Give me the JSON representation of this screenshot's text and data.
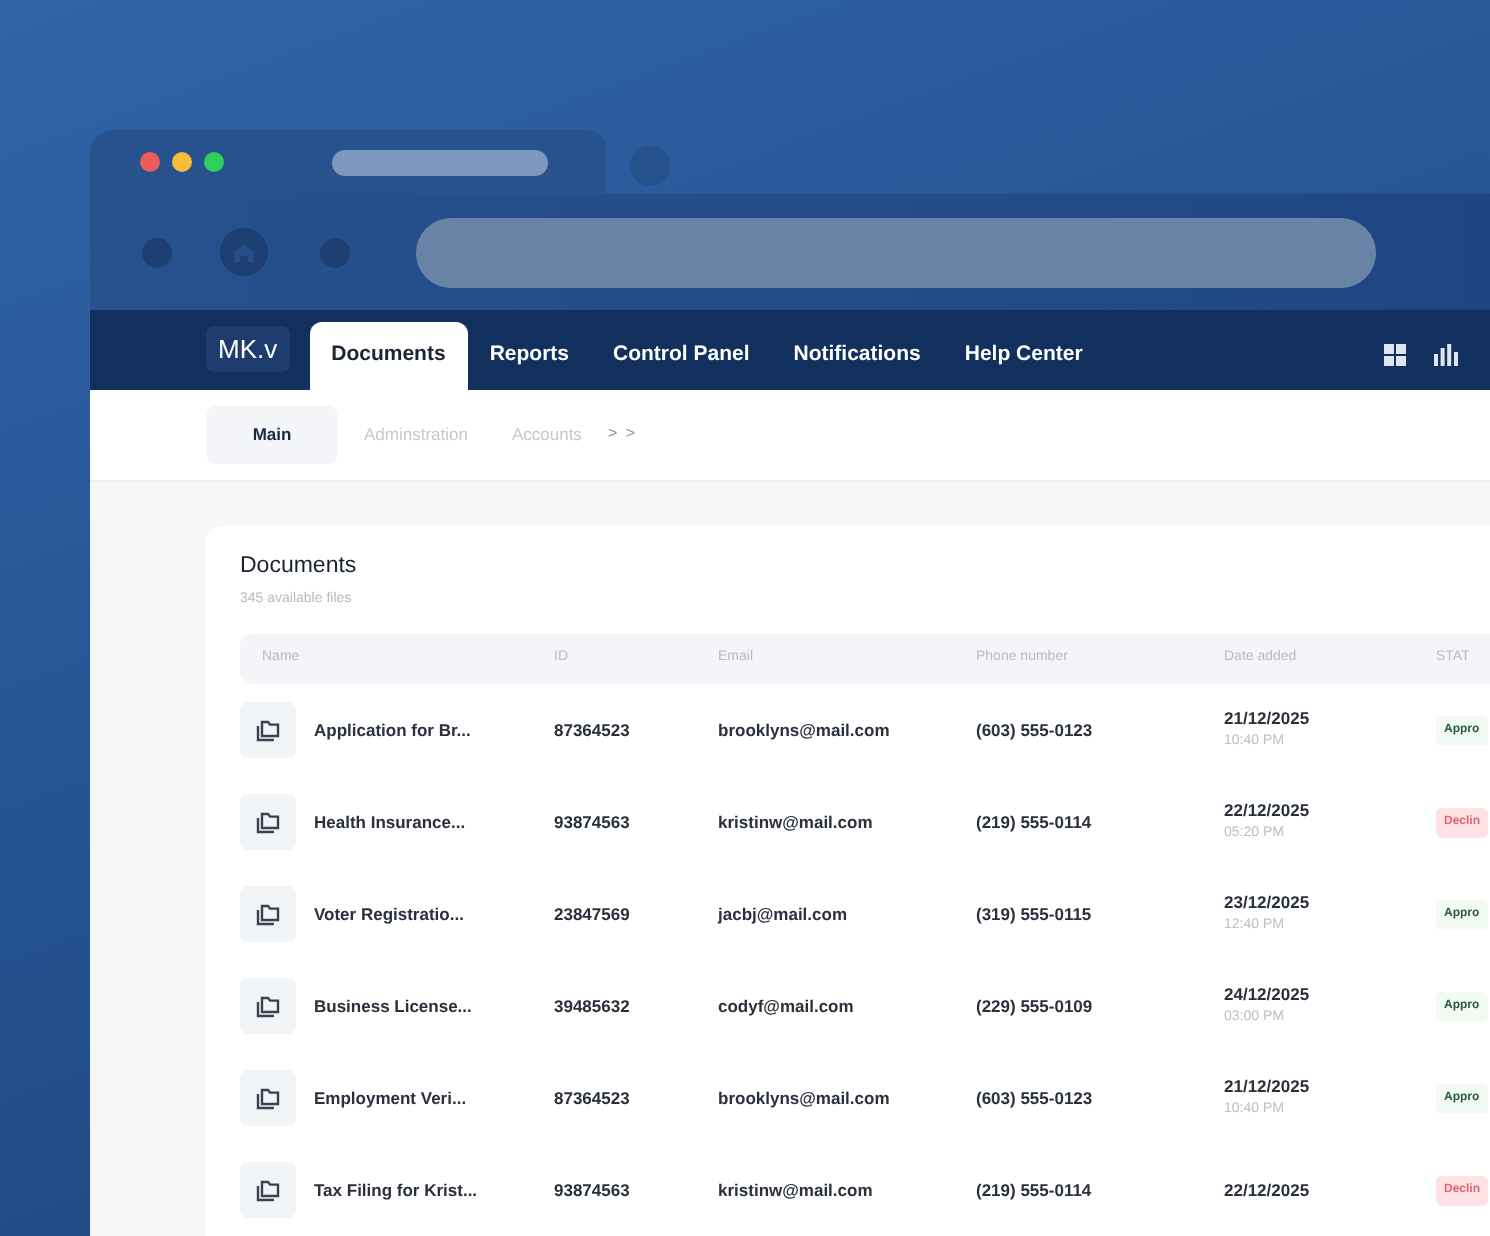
{
  "app_nav": {
    "logo": "MK.v",
    "tabs": [
      {
        "label": "Documents",
        "selected": true
      },
      {
        "label": "Reports",
        "selected": false
      },
      {
        "label": "Control Panel",
        "selected": false
      },
      {
        "label": "Notifications",
        "selected": false
      },
      {
        "label": "Help Center",
        "selected": false
      }
    ]
  },
  "sub_nav": {
    "tabs": [
      {
        "label": "Main",
        "selected": true
      },
      {
        "label": "Adminstration",
        "selected": false
      },
      {
        "label": "Accounts",
        "selected": false
      }
    ],
    "more": "> >"
  },
  "documents": {
    "title": "Documents",
    "subtitle": "345 available files",
    "columns": [
      "Name",
      "ID",
      "Email",
      "Phone number",
      "Date added",
      "STAT"
    ],
    "rows": [
      {
        "name": "Application for Br...",
        "id": "87364523",
        "email": "brooklyns@mail.com",
        "phone": "(603) 555-0123",
        "date": "21/12/2025",
        "time": "10:40 PM",
        "status": {
          "kind": "approved",
          "label": "Appro"
        }
      },
      {
        "name": "Health Insurance...",
        "id": "93874563",
        "email": "kristinw@mail.com",
        "phone": "(219) 555-0114",
        "date": "22/12/2025",
        "time": "05:20 PM",
        "status": {
          "kind": "declined",
          "label": "Declin"
        }
      },
      {
        "name": "Voter Registratio...",
        "id": "23847569",
        "email": "jacbj@mail.com",
        "phone": "(319) 555-0115",
        "date": "23/12/2025",
        "time": "12:40 PM",
        "status": {
          "kind": "approved",
          "label": "Appro"
        }
      },
      {
        "name": "Business License...",
        "id": "39485632",
        "email": "codyf@mail.com",
        "phone": "(229) 555-0109",
        "date": "24/12/2025",
        "time": "03:00 PM",
        "status": {
          "kind": "approved",
          "label": "Appro"
        }
      },
      {
        "name": "Employment Veri...",
        "id": "87364523",
        "email": "brooklyns@mail.com",
        "phone": "(603) 555-0123",
        "date": "21/12/2025",
        "time": "10:40 PM",
        "status": {
          "kind": "approved",
          "label": "Appro"
        }
      },
      {
        "name": "Tax Filing for Krist...",
        "id": "93874563",
        "email": "kristinw@mail.com",
        "phone": "(219) 555-0114",
        "date": "22/12/2025",
        "status": {
          "kind": "declined",
          "label": "Declin"
        }
      }
    ]
  }
}
